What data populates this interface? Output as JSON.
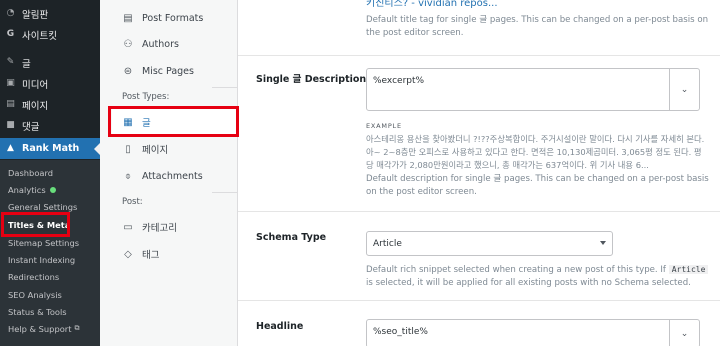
{
  "sidebar": {
    "top_items": [
      {
        "icon": "speedometer-icon",
        "label": "알림판"
      },
      {
        "icon": "g-logo-icon",
        "label": "사이트킷"
      },
      {
        "icon": "pin-icon",
        "label": "글"
      },
      {
        "icon": "media-icon",
        "label": "미디어"
      },
      {
        "icon": "page-icon",
        "label": "페이지"
      },
      {
        "icon": "comment-icon",
        "label": "댓글"
      },
      {
        "icon": "rank-math-icon",
        "label": "Rank Math"
      }
    ],
    "submenu": [
      {
        "label": "Dashboard"
      },
      {
        "label": "Analytics"
      },
      {
        "label": "General Settings"
      },
      {
        "label": "Titles & Meta"
      },
      {
        "label": "Sitemap Settings"
      },
      {
        "label": "Instant Indexing"
      },
      {
        "label": "Redirections"
      },
      {
        "label": "SEO Analysis"
      },
      {
        "label": "Status & Tools"
      },
      {
        "label": "Help & Support"
      }
    ],
    "analytics_dot_color": "#68de7c",
    "active_color": "#2271b1"
  },
  "tabs": {
    "items": [
      {
        "icon": "post-formats-icon",
        "label": "Post Formats"
      },
      {
        "icon": "authors-icon",
        "label": "Authors"
      },
      {
        "icon": "misc-pages-icon",
        "label": "Misc Pages"
      }
    ],
    "post_types_label": "Post Types:",
    "post_types": [
      {
        "icon": "post-icon",
        "label": "글"
      },
      {
        "icon": "page-icon",
        "label": "페이지"
      },
      {
        "icon": "attachment-icon",
        "label": "Attachments"
      }
    ],
    "post_label": "Post:",
    "taxonomies": [
      {
        "icon": "folder-icon",
        "label": "카테고리"
      },
      {
        "icon": "tag-icon",
        "label": "태그"
      }
    ]
  },
  "main": {
    "title_link_cut": "키친티스? - vividian repos...",
    "title_desc": "Default title tag for single 글 pages. This can be changed on a per-post basis on the post editor screen.",
    "description": {
      "label": "Single 글 Description",
      "value": "%excerpt%",
      "example_label": "EXAMPLE",
      "example_text": "아스테리옹 용산을 찾아봤더니 ?!??주상복합이다. 주거시설이란 말이다. 다시 기사를 자세히 본다. 아~ 2~8층만 오피스로 사용하고 있다고 한다. 면적은 10,130제곱미터. 3,065평 정도 된다. 평당 매각가가 2,080만원이라고 했으니, 총 매각가는 637억이다. 위 기사 내용 6...",
      "help": "Default description for single 글 pages. This can be changed on a per-post basis on the post editor screen."
    },
    "schema": {
      "label": "Schema Type",
      "value": "Article",
      "help_before": "Default rich snippet selected when creating a new post of this type. If",
      "help_code": "Article",
      "help_after": "is selected, it will be applied for all existing posts with no Schema selected."
    },
    "headline": {
      "label": "Headline",
      "value": "%seo_title%"
    }
  },
  "highlight_color": "#e60012"
}
